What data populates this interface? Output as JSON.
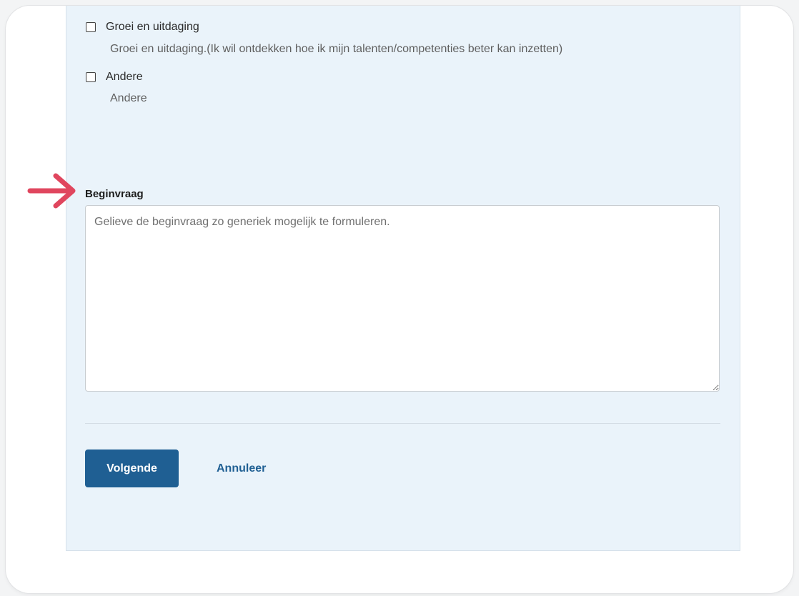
{
  "options": [
    {
      "label": "Groei en uitdaging",
      "description": "Groei en uitdaging.(Ik wil ontdekken hoe ik mijn talenten/competenties beter kan inzetten)",
      "checked": false
    },
    {
      "label": "Andere",
      "description": "Andere",
      "checked": false
    }
  ],
  "beginvraag": {
    "label": "Beginvraag",
    "placeholder": "Gelieve de beginvraag zo generiek mogelijk te formuleren.",
    "value": ""
  },
  "actions": {
    "next_label": "Volgende",
    "cancel_label": "Annuleer"
  },
  "annotation": {
    "icon": "arrow-right-icon",
    "color": "#e0465e"
  },
  "colors": {
    "panel_bg": "#eaf3fa",
    "primary": "#1f5f93"
  }
}
